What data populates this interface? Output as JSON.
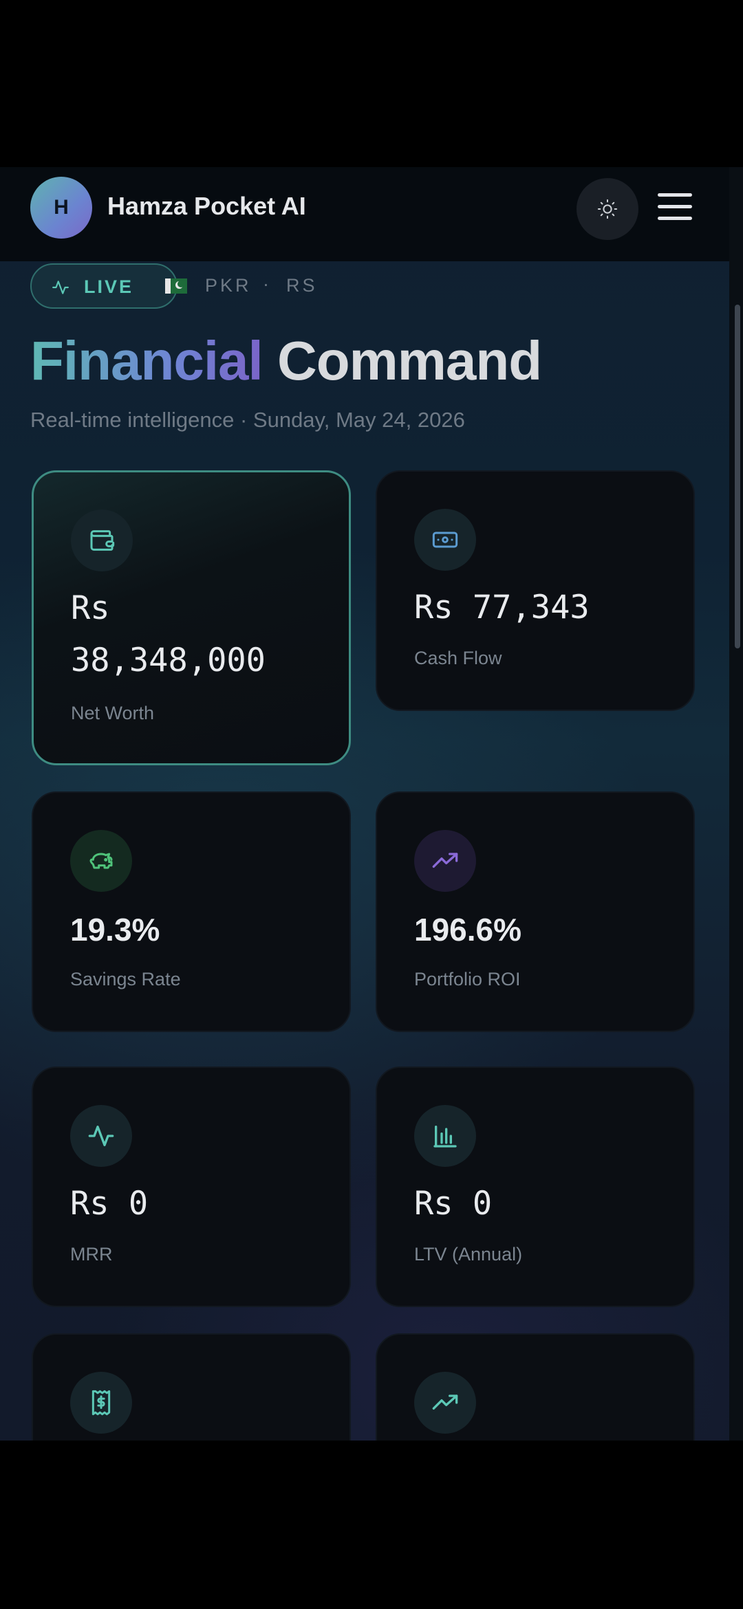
{
  "app": {
    "avatar_initial": "H",
    "title": "Hamza Pocket AI"
  },
  "status": {
    "live_label": "LIVE",
    "currency_code": "PKR",
    "separator": "·",
    "currency_symbol": "RS"
  },
  "headline": {
    "part1": "Financial",
    "part2": "Command"
  },
  "subline": "Real-time intelligence · Sunday, May 24, 2026",
  "cards": [
    {
      "icon": "wallet-icon",
      "value_line1": "Rs",
      "value_line2": "38,348,000",
      "label": "Net Worth",
      "active": true
    },
    {
      "icon": "banknote-icon",
      "value": "Rs 77,343",
      "label": "Cash Flow"
    },
    {
      "icon": "piggy-bank-icon",
      "value": "19.3%",
      "label": "Savings Rate"
    },
    {
      "icon": "trending-up-icon",
      "value": "196.6%",
      "label": "Portfolio ROI"
    },
    {
      "icon": "activity-icon",
      "value": "Rs 0",
      "label": "MRR"
    },
    {
      "icon": "bar-chart-icon",
      "value": "Rs 0",
      "label": "LTV (Annual)"
    },
    {
      "icon": "receipt-icon"
    },
    {
      "icon": "trending-up-icon"
    }
  ],
  "colors": {
    "accent_teal": "#5cc8b6",
    "accent_purple": "#7a64c8",
    "card_bg": "#0b0e13"
  }
}
